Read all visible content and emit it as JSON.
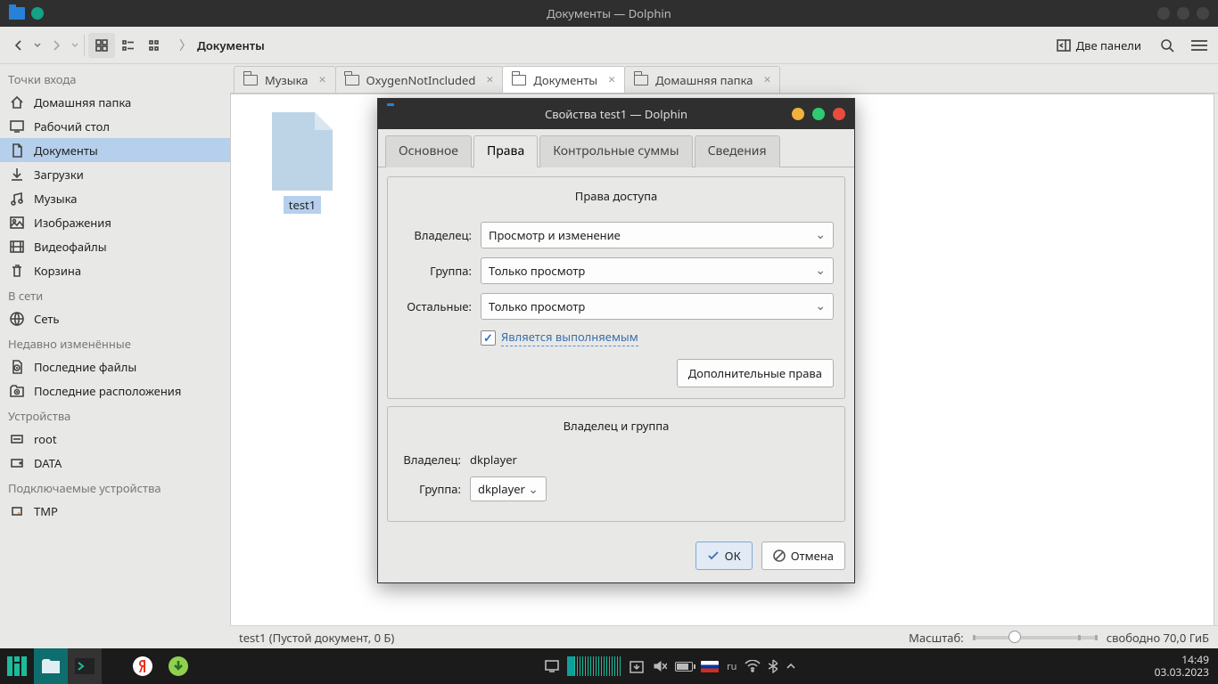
{
  "titlebar": {
    "title": "Документы — Dolphin"
  },
  "toolbar": {
    "breadcrumb": "Документы",
    "panels": "Две панели"
  },
  "sidebar": {
    "section_places": "Точки входа",
    "section_network": "В сети",
    "section_recent": "Недавно изменённые",
    "section_devices": "Устройства",
    "section_removable": "Подключаемые устройства",
    "home": "Домашняя папка",
    "desktop": "Рабочий стол",
    "documents": "Документы",
    "downloads": "Загрузки",
    "music": "Музыка",
    "images": "Изображения",
    "videos": "Видеофайлы",
    "trash": "Корзина",
    "network": "Сеть",
    "recent_files": "Последние файлы",
    "recent_places": "Последние расположения",
    "root": "root",
    "data": "DATA",
    "tmp": "TMP"
  },
  "tabs": {
    "t1": "Музыка",
    "t2": "OxygenNotIncluded",
    "t3": "Документы",
    "t4": "Домашняя папка"
  },
  "view": {
    "file1": "test1"
  },
  "statusbar": {
    "summary": "test1 (Пустой документ, 0 Б)",
    "zoom_label": "Масштаб:",
    "free": "свободно 70,0 ГиБ"
  },
  "dialog": {
    "title": "Свойства test1 — Dolphin",
    "tab_general": "Основное",
    "tab_perms": "Права",
    "tab_checksums": "Контрольные суммы",
    "tab_details": "Сведения",
    "perms_header": "Права доступа",
    "owner_header": "Владелец и группа",
    "lbl_owner": "Владелец:",
    "lbl_group": "Группа:",
    "lbl_others": "Остальные:",
    "val_owner": "Просмотр и изменение",
    "val_group": "Только просмотр",
    "val_others": "Только просмотр",
    "executable": "Является выполняемым",
    "advanced": "Дополнительные права",
    "owner_user": "dkplayer",
    "owner_group": "dkplayer",
    "ok": "ОК",
    "cancel": "Отмена"
  },
  "taskbar": {
    "time": "14:49",
    "date": "03.03.2023",
    "lang": "ru"
  }
}
